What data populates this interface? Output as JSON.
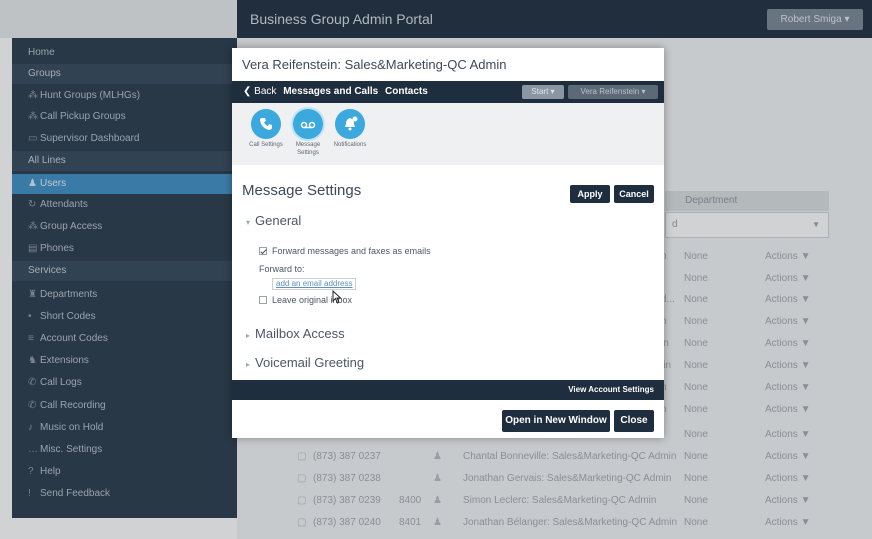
{
  "portal": {
    "title": "Business Group Admin Portal",
    "user_menu": "Robert Smiga ▾"
  },
  "sidebar": {
    "home": "Home",
    "groups_header": "Groups",
    "hunt_groups": "Hunt Groups (MLHGs)",
    "call_pickup": "Call Pickup Groups",
    "supervisor": "Supervisor Dashboard",
    "all_lines_header": "All Lines",
    "users": "Users",
    "attendants": "Attendants",
    "group_access": "Group Access",
    "phones": "Phones",
    "services_header": "Services",
    "departments": "Departments",
    "short_codes": "Short Codes",
    "account_codes": "Account Codes",
    "extensions": "Extensions",
    "call_logs": "Call Logs",
    "call_recording": "Call Recording",
    "music_on_hold": "Music on Hold",
    "misc_settings": "Misc. Settings",
    "help": "Help",
    "send_feedback": "Send Feedback"
  },
  "table": {
    "department_header": "Department",
    "filter_value": "d",
    "bg_rows": [
      {
        "user_tail": "n",
        "dept": "None",
        "action": "Actions ▼"
      },
      {
        "user_tail": "",
        "dept": "None",
        "action": "Actions ▼"
      },
      {
        "user_tail": "d...",
        "dept": "None",
        "action": "Actions ▼"
      },
      {
        "user_tail": "h",
        "dept": "None",
        "action": "Actions ▼"
      },
      {
        "user_tail": "in",
        "dept": "None",
        "action": "Actions ▼"
      },
      {
        "user_tail": "lin",
        "dept": "None",
        "action": "Actions ▼"
      },
      {
        "user_tail": "h",
        "dept": "None",
        "action": "Actions ▼"
      },
      {
        "user_tail": "n",
        "dept": "None",
        "action": "Actions ▼"
      },
      {
        "user_tail": "",
        "dept": "None",
        "action": "Actions ▼"
      }
    ],
    "rows": [
      {
        "phone": "(873) 387 0237",
        "ext": "",
        "user": "Chantal Bonneville: Sales&Marketing-QC Admin",
        "dept": "None",
        "action": "Actions ▼"
      },
      {
        "phone": "(873) 387 0238",
        "ext": "",
        "user": "Jonathan Gervais: Sales&Marketing-QC Admin",
        "dept": "None",
        "action": "Actions ▼"
      },
      {
        "phone": "(873) 387 0239",
        "ext": "8400",
        "user": "Simon Leclerc: Sales&Marketing-QC Admin",
        "dept": "None",
        "action": "Actions ▼"
      },
      {
        "phone": "(873) 387 0240",
        "ext": "8401",
        "user": "Jonathan Bélanger: Sales&Marketing-QC Admin",
        "dept": "None",
        "action": "Actions ▼"
      }
    ]
  },
  "modal": {
    "title": "Vera Reifenstein: Sales&Marketing-QC Admin",
    "nav_back": "Back",
    "nav_messages": "Messages and Calls",
    "nav_contacts": "Contacts",
    "start": "Start ▾",
    "user_dropdown": "Vera Reifenstein ▾",
    "tiles": [
      {
        "label": "Call Settings",
        "icon": "call-settings-icon"
      },
      {
        "label": "Message Settings",
        "icon": "message-settings-icon"
      },
      {
        "label": "Notifications",
        "icon": "notifications-icon"
      }
    ],
    "section_title": "Message Settings",
    "apply": "Apply",
    "cancel": "Cancel",
    "general": "General",
    "forward_checkbox": "Forward messages and faxes as emails",
    "forward_to": "Forward to:",
    "email_placeholder": "add an email address",
    "leave_original": "Leave original inbox",
    "mailbox_access": "Mailbox Access",
    "voicemail_greeting": "Voicemail Greeting",
    "view_account_settings": "View Account Settings",
    "open_new_window": "Open in New Window",
    "close": "Close"
  }
}
